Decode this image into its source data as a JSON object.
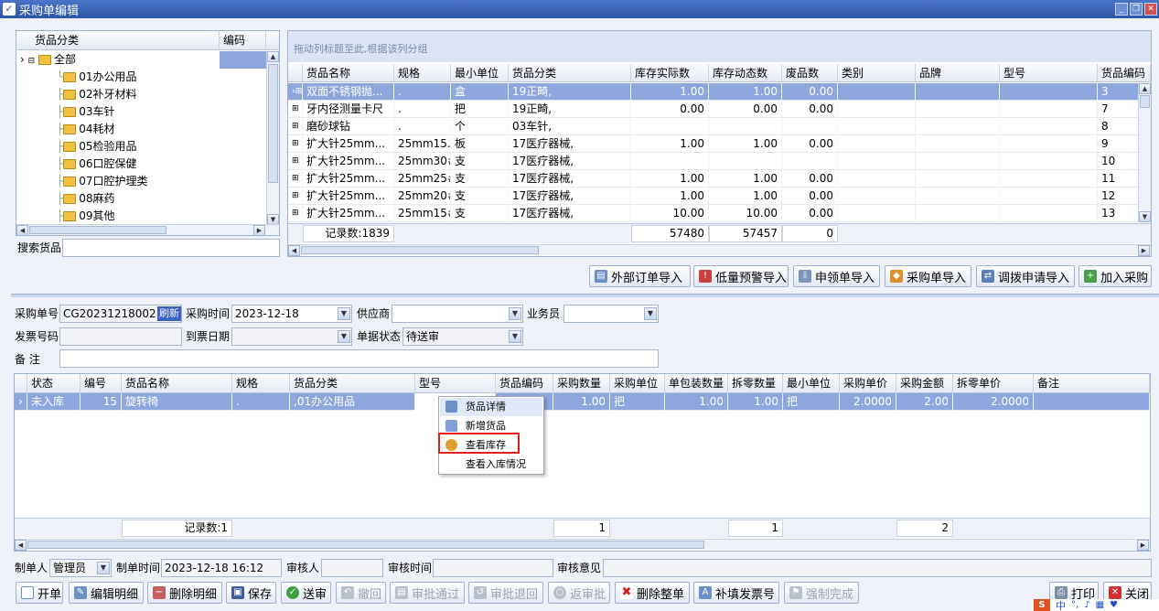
{
  "window": {
    "title": "采购单编辑"
  },
  "category_tree": {
    "headers": [
      "货品分类",
      "编码"
    ],
    "root": "全部",
    "items": [
      "01办公用品",
      "02补牙材料",
      "03车针",
      "04耗材",
      "05检验用品",
      "06口腔保健",
      "07口腔护理类",
      "08麻药",
      "09其他"
    ]
  },
  "search": {
    "label": "搜索货品",
    "value": ""
  },
  "product_grid": {
    "group_hint": "拖动列标题至此,根据该列分组",
    "columns": [
      "货品名称",
      "规格",
      "最小单位",
      "货品分类",
      "库存实际数",
      "库存动态数",
      "废品数",
      "类别",
      "品牌",
      "型号",
      "货品编码"
    ],
    "rows": [
      [
        "双面不锈钢抛...",
        ".",
        "盒",
        "19正畸,",
        "1.00",
        "1.00",
        "0.00",
        "",
        "",
        "",
        "3"
      ],
      [
        "牙内径测量卡尺",
        ".",
        "把",
        "19正畸,",
        "0.00",
        "0.00",
        "0.00",
        "",
        "",
        "",
        "7"
      ],
      [
        "磨砂球钻",
        ".",
        "个",
        "03车针,",
        "",
        "",
        "",
        "",
        "",
        "",
        "8"
      ],
      [
        "扩大针25mm...",
        "25mm15...",
        "板",
        "17医疗器械,",
        "1.00",
        "1.00",
        "0.00",
        "",
        "",
        "",
        "9"
      ],
      [
        "扩大针25mm...",
        "25mm30#",
        "支",
        "17医疗器械,",
        "",
        "",
        "",
        "",
        "",
        "",
        "10"
      ],
      [
        "扩大针25mm...",
        "25mm25#",
        "支",
        "17医疗器械,",
        "1.00",
        "1.00",
        "0.00",
        "",
        "",
        "",
        "11"
      ],
      [
        "扩大针25mm...",
        "25mm20#",
        "支",
        "17医疗器械,",
        "1.00",
        "1.00",
        "0.00",
        "",
        "",
        "",
        "12"
      ],
      [
        "扩大针25mm...",
        "25mm15#",
        "支",
        "17医疗器械,",
        "10.00",
        "10.00",
        "0.00",
        "",
        "",
        "",
        "13"
      ]
    ],
    "footer": {
      "count": "记录数:1839",
      "actual": "57480",
      "dynamic": "57457",
      "waste": "0"
    }
  },
  "import_buttons": [
    "外部订单导入",
    "低量预警导入",
    "申领单导入",
    "采购单导入",
    "调拨申请导入",
    "加入采购"
  ],
  "form": {
    "order_no_label": "采购单号",
    "order_no": "CG20231218002",
    "refresh": "刷新",
    "time_label": "采购时间",
    "time": "2023-12-18",
    "supplier_label": "供应商",
    "supplier": "",
    "salesman_label": "业务员",
    "salesman": "",
    "invoice_label": "发票号码",
    "invoice": "",
    "arrival_label": "到票日期",
    "arrival": "",
    "status_label": "单据状态",
    "status": "待送审",
    "note_label": "备 注",
    "note": ""
  },
  "detail_grid": {
    "columns": [
      "状态",
      "编号",
      "货品名称",
      "规格",
      "货品分类",
      "型号",
      "货品编码",
      "采购数量",
      "采购单位",
      "单包装数量",
      "拆零数量",
      "最小单位",
      "采购单价",
      "采购金额",
      "拆零单价",
      "备注"
    ],
    "rows": [
      [
        "未入库",
        "15",
        "旋转椅",
        ".",
        ",01办公用品",
        "",
        "",
        "1.00",
        "把",
        "1.00",
        "1.00",
        "把",
        "2.0000",
        "2.00",
        "2.0000",
        ""
      ]
    ],
    "footer": {
      "count": "记录数:1",
      "qty": "1",
      "split": "1",
      "amount": "2"
    }
  },
  "context_menu": [
    "货品详情",
    "新增货品",
    "查看库存",
    "查看入库情况"
  ],
  "audit": {
    "maker_label": "制单人",
    "maker": "管理员",
    "make_time_label": "制单时间",
    "make_time": "2023-12-18 16:12",
    "auditor_label": "审核人",
    "auditor": "",
    "audit_time_label": "审核时间",
    "audit_time": "",
    "audit_opinion_label": "审核意见",
    "audit_opinion": ""
  },
  "bottom_buttons": [
    "开单",
    "编辑明细",
    "删除明细",
    "保存",
    "送审",
    "撤回",
    "审批通过",
    "审批退回",
    "返审批",
    "删除整单",
    "补填发票号",
    "强制完成",
    "打印",
    "关闭"
  ],
  "tray": {
    "ime": "中"
  },
  "colors": {
    "title_bar": "#2d55a8",
    "selected_row": "#8ea6de",
    "highlight_box": "#e0201e"
  }
}
